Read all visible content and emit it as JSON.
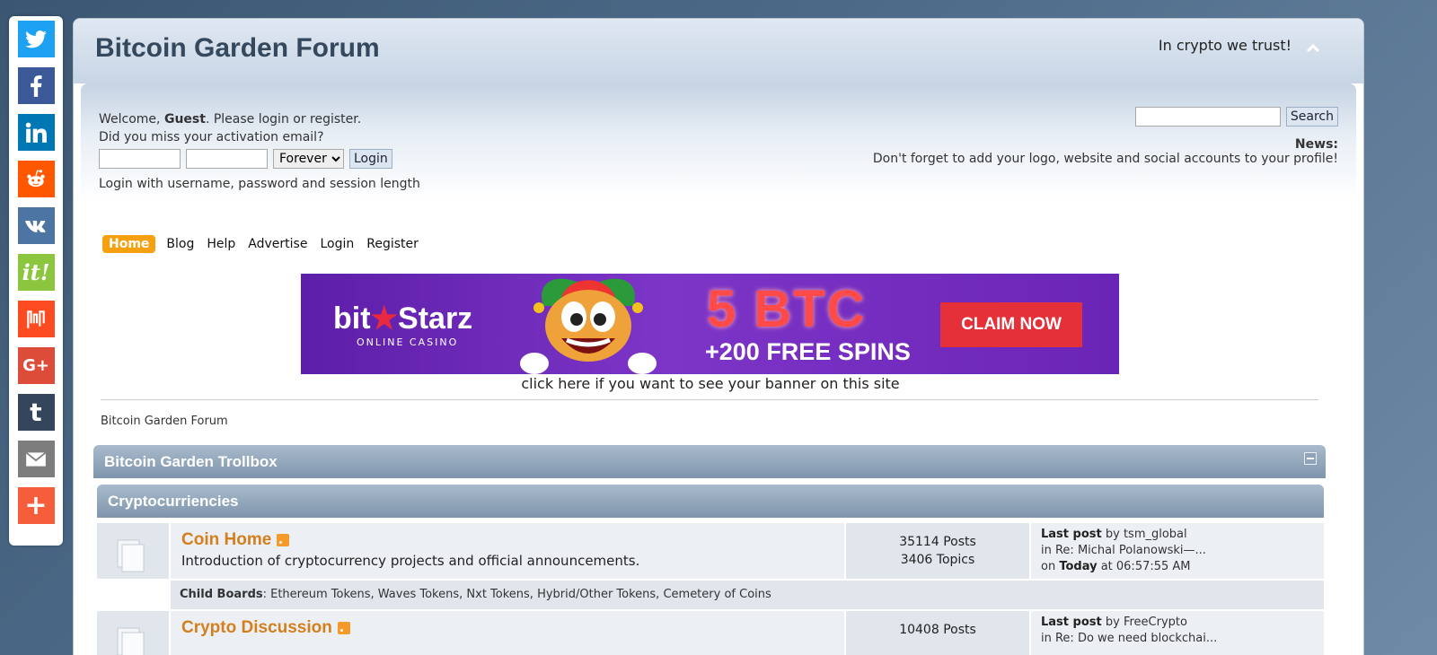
{
  "share": [
    {
      "name": "twitter",
      "color": "#1da1f2"
    },
    {
      "name": "facebook",
      "color": "#3b5998"
    },
    {
      "name": "linkedin",
      "color": "#0077b5"
    },
    {
      "name": "reddit",
      "color": "#ff5700"
    },
    {
      "name": "vk",
      "color": "#4c75a3"
    },
    {
      "name": "itlink",
      "color": "#8cc63f",
      "label": "it!"
    },
    {
      "name": "mix",
      "color": "#fd4b21"
    },
    {
      "name": "googleplus",
      "color": "#dd4b39",
      "label": "G+"
    },
    {
      "name": "tumblr",
      "color": "#35465c",
      "label": "t"
    },
    {
      "name": "email",
      "color": "#7d7d7d"
    },
    {
      "name": "more",
      "color": "#f65e3b",
      "label": "+"
    }
  ],
  "header": {
    "title": "Bitcoin Garden Forum",
    "slogan": "In crypto we trust!"
  },
  "user": {
    "welcome_pre": "Welcome, ",
    "guest": "Guest",
    "welcome_post": ". Please login or register.",
    "activation": "Did you miss your activation email?",
    "session_option": "Forever",
    "login_button": "Login",
    "login_note": "Login with username, password and session length"
  },
  "search": {
    "button": "Search",
    "value": ""
  },
  "news": {
    "title": "News:",
    "text": "Don't forget to add your logo, website and social accounts to your profile!"
  },
  "menu": [
    "Home",
    "Blog",
    "Help",
    "Advertise",
    "Login",
    "Register"
  ],
  "banner": {
    "brand_a": "bit",
    "brand_star": "★",
    "brand_b": "Starz",
    "sub": "ONLINE CASINO",
    "amount": "5 BTC",
    "spins": "+200 FREE SPINS",
    "cta": "CLAIM NOW",
    "link_text": "click here if you want to see your banner on this site"
  },
  "breadcrumb": "Bitcoin Garden Forum",
  "categories": {
    "trollbox": "Bitcoin Garden Trollbox",
    "crypto": "Cryptocurriencies"
  },
  "boards": [
    {
      "name": "Coin Home",
      "desc": "Introduction of cryptocurrency projects and official announcements.",
      "posts": "35114 Posts",
      "topics": "3406 Topics",
      "last_label": "Last post",
      "last_by": " by tsm_global",
      "last_in": "in Re: Michal Polanowski—...",
      "last_on_pre": "on ",
      "last_today": "Today",
      "last_time": " at 06:57:55 AM",
      "child_label": "Child Boards",
      "children": ": Ethereum Tokens, Waves Tokens, Nxt Tokens, Hybrid/Other Tokens, Cemetery of Coins"
    },
    {
      "name": "Crypto Discussion",
      "posts": "10408 Posts",
      "last_label": "Last post",
      "last_by": " by FreeCrypto",
      "last_in": "in Re: Do we need blockchai..."
    }
  ]
}
